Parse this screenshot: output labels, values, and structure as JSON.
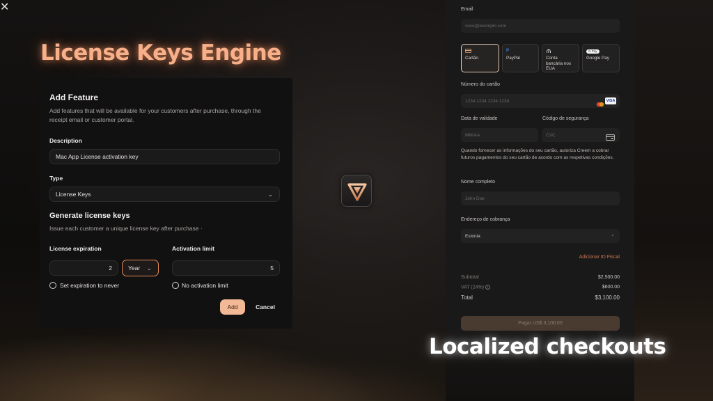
{
  "headlines": {
    "left": "License Keys Engine",
    "right": "Localized checkouts"
  },
  "dialog": {
    "title": "Add Feature",
    "description": "Add features that will be available for your customers after purchase, through the receipt email or customer portal.",
    "description_label": "Description",
    "description_value": "Mac App License activation key",
    "type_label": "Type",
    "type_value": "License Keys",
    "section_title": "Generate license keys",
    "section_subtitle": "Issue each customer a unique license key after purchase ·",
    "expiration_label": "License expiration",
    "expiration_value": "2",
    "expiration_unit": "Year",
    "activation_label": "Activation limit",
    "activation_value": "5",
    "never_expire_label": "Set expiration to never",
    "no_limit_label": "No activation limit",
    "add_label": "Add",
    "cancel_label": "Cancel",
    "close_glyph": "✕"
  },
  "checkout": {
    "email_label": "Email",
    "email_placeholder": "voce@exemplo.com",
    "payment_methods": [
      {
        "label": "Cartão",
        "icon": "card-icon",
        "selected": true
      },
      {
        "label": "PayPal",
        "icon": "paypal-icon",
        "selected": false
      },
      {
        "label": "Conta bancária nos EUA",
        "icon": "bank-icon",
        "selected": false
      },
      {
        "label": "Google Pay",
        "icon": "gpay-icon",
        "selected": false
      }
    ],
    "gpay_badge": "G Pay",
    "card_number_label": "Número do cartão",
    "card_number_placeholder": "1234 1234 1234 1234",
    "visa_label": "VISA",
    "expiry_label": "Data de validade",
    "expiry_placeholder": "MM/AA",
    "cvc_label": "Código de segurança",
    "cvc_placeholder": "CVC",
    "consent_text": "Quando fornecer as informações do seu cartão, autoriza Creem a cobrar futuros pagamentos do seu cartão de acordo com as respetivas condições.",
    "full_name_label": "Nome completo",
    "full_name_placeholder": "John Doe",
    "billing_label": "Endereço de cobrança",
    "country_value": "Estonia",
    "tax_id_link": "Adicionar ID Fiscal",
    "subtotal_label": "Subtotal",
    "subtotal_value": "$2,500.00",
    "vat_label": "VAT (24%)",
    "vat_value": "$600.00",
    "total_label": "Total",
    "total_value": "$3,100.00",
    "pay_button": "Pagar US$ 3,100.00"
  },
  "colors": {
    "accent": "#f3b896",
    "headline_glow": "#f7b08a",
    "panel": "#1a1919",
    "dialog": "#121111"
  }
}
